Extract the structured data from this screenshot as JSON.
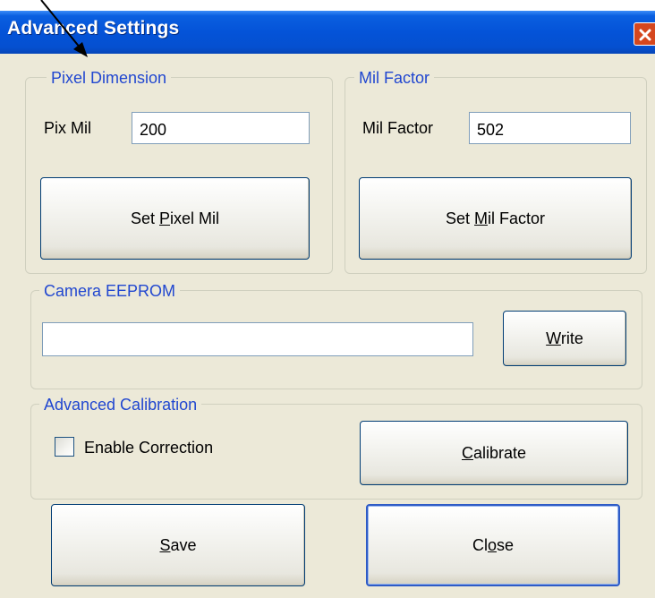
{
  "window": {
    "title": "Advanced Settings"
  },
  "pixel_dimension": {
    "legend": "Pixel Dimension",
    "field_label": "Pix Mil",
    "field_value": "200",
    "button": {
      "before": "Set ",
      "mnemonic": "P",
      "after": "ixel Mil"
    }
  },
  "mil_factor": {
    "legend": "Mil Factor",
    "field_label": "Mil Factor",
    "field_value": "502",
    "button": {
      "before": "Set ",
      "mnemonic": "M",
      "after": "il Factor"
    }
  },
  "camera_eeprom": {
    "legend": "Camera EEPROM",
    "field_value": "",
    "button": {
      "before": "",
      "mnemonic": "W",
      "after": "rite"
    }
  },
  "advanced_calibration": {
    "legend": "Advanced Calibration",
    "checkbox_label": "Enable Correction",
    "checkbox_checked": false,
    "button": {
      "before": "",
      "mnemonic": "C",
      "after": "alibrate"
    }
  },
  "footer": {
    "save_button": {
      "before": "",
      "mnemonic": "S",
      "after": "ave"
    },
    "close_button": {
      "before": "Cl",
      "mnemonic": "o",
      "after": "se"
    }
  },
  "icons": {
    "close": "close-x-icon",
    "annotation": "arrow-annotation-icon"
  },
  "colors": {
    "title_bar": "#0453d8",
    "close_button": "#d5471e",
    "legend_text": "#2147d0",
    "dialog_bg": "#ece9d8",
    "annotation": "#000000"
  }
}
